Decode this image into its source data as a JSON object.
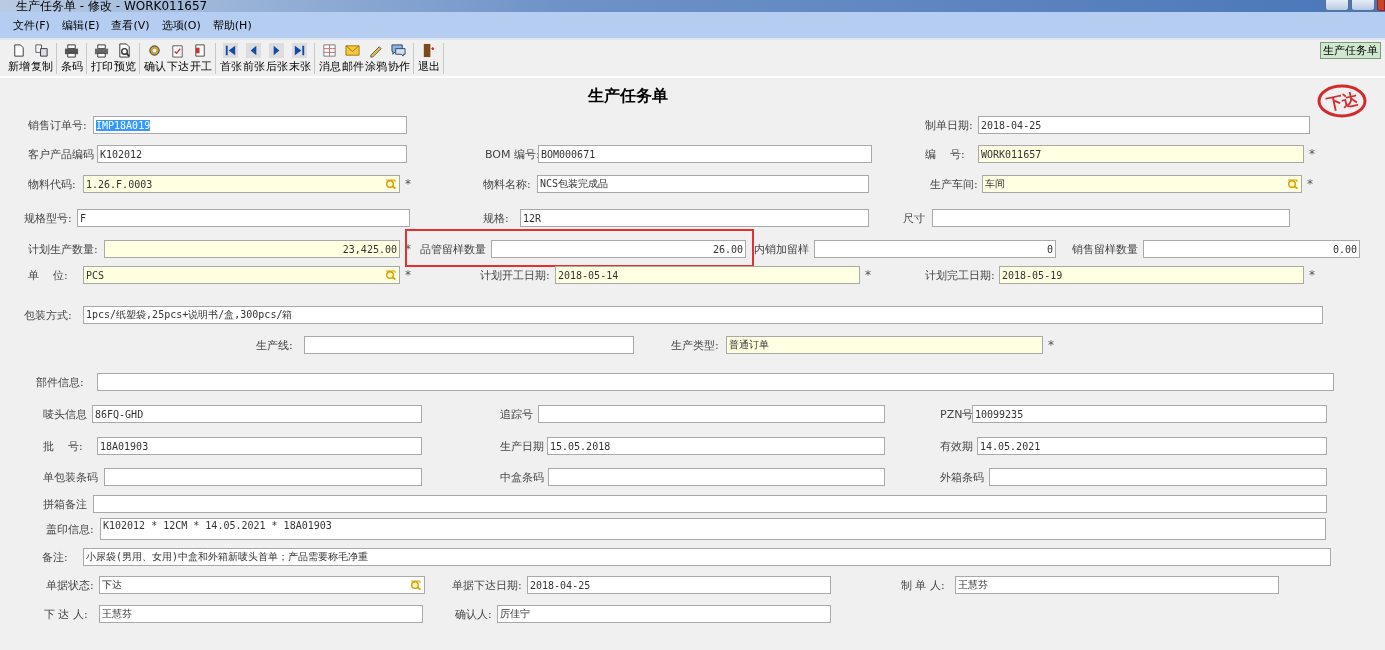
{
  "window": {
    "title": "生产任务单 - 修改 - WORK011657"
  },
  "menu": [
    "文件(F)",
    "编辑(E)",
    "查看(V)",
    "选项(O)",
    "帮助(H)"
  ],
  "toolbar": [
    [
      "新增",
      "复制"
    ],
    [
      "条码"
    ],
    [
      "打印",
      "预览"
    ],
    [
      "确认",
      "下达",
      "开工"
    ],
    [
      "首张",
      "前张",
      "后张",
      "末张"
    ],
    [
      "消息",
      "邮件",
      "涂鸦",
      "协作"
    ],
    [
      "退出"
    ]
  ],
  "module_label": "生产任务单",
  "form": {
    "title": "生产任务单",
    "stamp": "下达",
    "rows": [
      [
        {
          "label": "销售订单号:",
          "value": "IMP18A019",
          "kind": "text",
          "required": false,
          "text_selected": true
        },
        {
          "label": "制单日期:",
          "value": "2018-04-25",
          "kind": "text",
          "required": false
        }
      ],
      [
        {
          "label": "客户产品编码",
          "value": "K102012",
          "kind": "text",
          "required": false
        },
        {
          "label": "BOM 编号:",
          "value": "BOM000671",
          "kind": "text",
          "required": false
        },
        {
          "label": "编    号:",
          "value": "WORK011657",
          "kind": "text",
          "required": true,
          "mark": "*"
        }
      ],
      [
        {
          "label": "物料代码:",
          "value": "1.26.F.0003",
          "kind": "lookup",
          "required": true,
          "mark": "*"
        },
        {
          "label": "物料名称:",
          "value": "NCS包装完成品",
          "kind": "text",
          "required": false
        },
        {
          "label": "生产车间:",
          "value": "车间",
          "kind": "lookup",
          "required": true,
          "mark": "*"
        }
      ],
      [
        {
          "label": "规格型号:",
          "value": "F",
          "kind": "text",
          "required": false
        },
        {
          "label": "规格:",
          "value": "12R",
          "kind": "text",
          "required": false
        },
        {
          "label": "尺寸",
          "kind": "text",
          "required": false
        }
      ],
      [
        {
          "label": "计划生产数量:",
          "value": "23,425.00",
          "kind": "number",
          "required": true,
          "mark": "*"
        },
        {
          "label": "品管留样数量",
          "value": "26.00",
          "kind": "number",
          "required": false,
          "outlined": true
        },
        {
          "label": "内销加留样",
          "value": "0",
          "kind": "number",
          "required": false
        },
        {
          "label": "销售留样数量",
          "value": "0.00",
          "kind": "number",
          "required": false
        }
      ],
      [
        {
          "label": "单    位:",
          "value": "PCS",
          "kind": "lookup",
          "required": true,
          "mark": "*"
        },
        {
          "label": "计划开工日期:",
          "value": "2018-05-14",
          "kind": "text",
          "required": true,
          "mark": "*"
        },
        {
          "label": "计划完工日期:",
          "value": "2018-05-19",
          "kind": "text",
          "required": true,
          "mark": "*"
        }
      ],
      [
        {
          "label": "包装方式:",
          "value": "1pcs/纸塑袋,25pcs+说明书/盒,300pcs/箱",
          "kind": "text",
          "required": false
        }
      ],
      [
        {
          "label": "生产线:",
          "kind": "text",
          "required": false
        },
        {
          "label": "生产类型:",
          "value": "普通订单",
          "kind": "text",
          "required": true,
          "mark": "*"
        }
      ],
      [
        {
          "label": "部件信息:",
          "kind": "text",
          "required": false
        }
      ],
      [
        {
          "label": "唛头信息",
          "value": "86FQ-GHD",
          "kind": "text",
          "required": false
        },
        {
          "label": "追踪号",
          "kind": "text",
          "required": false
        },
        {
          "label": "PZN号",
          "value": "10099235",
          "kind": "text",
          "required": false
        }
      ],
      [
        {
          "label": "批    号:",
          "value": "18A01903",
          "kind": "text",
          "required": false
        },
        {
          "label": "生产日期",
          "value": "15.05.2018",
          "kind": "text",
          "required": false
        },
        {
          "label": "有效期",
          "value": "14.05.2021",
          "kind": "text",
          "required": false
        }
      ],
      [
        {
          "label": "单包装条码",
          "kind": "text",
          "required": false
        },
        {
          "label": "中盒条码",
          "kind": "text",
          "required": false
        },
        {
          "label": "外箱条码",
          "kind": "text",
          "required": false
        }
      ],
      [
        {
          "label": "拼箱备注",
          "kind": "text",
          "required": false
        }
      ],
      [
        {
          "label": "盖印信息:",
          "value": "K102012 * 12CM * 14.05.2021 * 18A01903",
          "kind": "multiline",
          "required": false
        }
      ],
      [
        {
          "label": "备注:",
          "value": "小尿袋(男用、女用)中盒和外箱新唛头首单；产品需要称毛净重",
          "kind": "text",
          "required": false
        }
      ],
      [
        {
          "label": "单据状态:",
          "value": "下达",
          "kind": "lookup",
          "required": false
        },
        {
          "label": "单据下达日期:",
          "value": "2018-04-25",
          "kind": "text",
          "required": false
        },
        {
          "label": "制 单 人:",
          "value": "王慧芬",
          "kind": "text",
          "required": false
        }
      ],
      [
        {
          "label": "下 达 人:",
          "value": "王慧芬",
          "kind": "text",
          "required": false
        },
        {
          "label": "确认人:",
          "value": "厉佳宁",
          "kind": "text",
          "required": false
        }
      ]
    ]
  }
}
